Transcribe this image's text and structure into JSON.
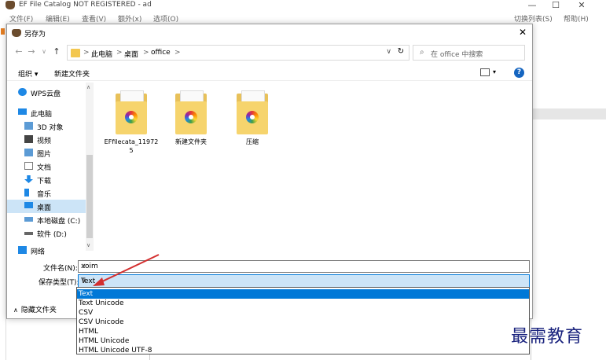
{
  "app": {
    "title": "EF File Catalog NOT REGISTERED - ad",
    "menu": [
      "文件(F)",
      "编辑(E)",
      "查看(V)",
      "额外(x)",
      "选项(O)"
    ],
    "right_menu": [
      "切换列表(S)",
      "帮助(H)"
    ],
    "window_buttons": [
      "—",
      "☐",
      "✕"
    ]
  },
  "dialog": {
    "title": "另存为",
    "close": "✕",
    "nav": {
      "back": "←",
      "forward": "→",
      "recent": "∨",
      "up": "↑"
    },
    "breadcrumb": [
      "此电脑",
      "桌面",
      "office"
    ],
    "crumb_sep": ">",
    "address_dropdown": "∨",
    "refresh": "↻",
    "search_icon": "⌕",
    "search_placeholder": "在 office 中搜索",
    "toolbar": {
      "organize": "组织 ▾",
      "new_folder": "新建文件夹",
      "view_drop": "▾",
      "help": "?"
    },
    "sidebar": [
      {
        "label": "WPS云盘",
        "icon": "cloud-icon",
        "color": "#1e88e5"
      },
      {
        "label": "此电脑",
        "icon": "computer-icon",
        "color": "#1e88e5"
      },
      {
        "label": "3D 对象",
        "icon": "cube-icon",
        "color": "#5c9bd5"
      },
      {
        "label": "视频",
        "icon": "video-icon",
        "color": "#444444"
      },
      {
        "label": "图片",
        "icon": "picture-icon",
        "color": "#5c9bd5"
      },
      {
        "label": "文档",
        "icon": "document-icon",
        "color": "#777777"
      },
      {
        "label": "下载",
        "icon": "download-icon",
        "color": "#1e88e5"
      },
      {
        "label": "音乐",
        "icon": "music-icon",
        "color": "#1e88e5"
      },
      {
        "label": "桌面",
        "icon": "desktop-icon",
        "color": "#1e88e5",
        "selected": true
      },
      {
        "label": "本地磁盘 (C:)",
        "icon": "drive-icon",
        "color": "#5c9bd5"
      },
      {
        "label": "软件 (D:)",
        "icon": "drive-icon",
        "color": "#666666"
      },
      {
        "label": "网络",
        "icon": "network-icon",
        "color": "#1e88e5"
      }
    ],
    "scroll_up": "∧",
    "scroll_down": "∨",
    "files": [
      {
        "label": "EFfilecata_119725"
      },
      {
        "label": "新建文件夹"
      },
      {
        "label": "压缩"
      }
    ],
    "filename_label": "文件名(N):",
    "filename_value": "xoim",
    "filetype_label": "保存类型(T):",
    "filetype_value": "Text",
    "select_drop": "∨",
    "hide_folders": "隐藏文件夹",
    "hide_chevron": "∧"
  },
  "dropdown": {
    "options": [
      "Text",
      "Text Unicode",
      "CSV",
      "CSV Unicode",
      "HTML",
      "HTML Unicode",
      "HTML Unicode UTF-8"
    ],
    "selected_index": 0
  },
  "watermark": "最需教育"
}
